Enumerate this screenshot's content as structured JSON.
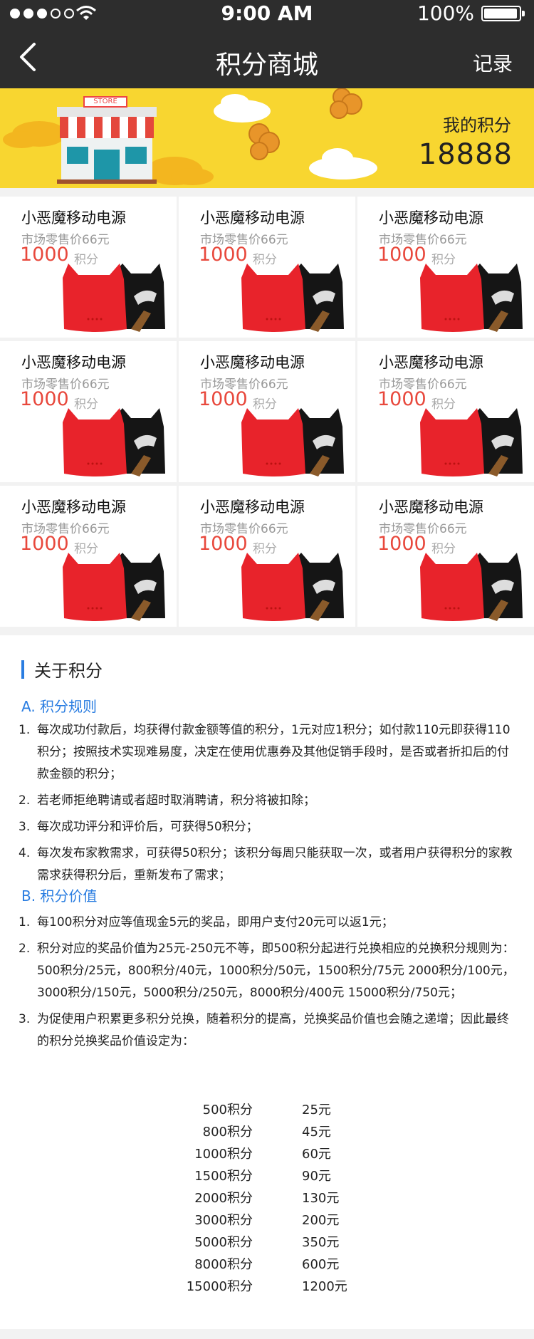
{
  "status_bar": {
    "time": "9:00 AM",
    "battery": "100%"
  },
  "nav": {
    "title": "积分商城",
    "right_action": "记录"
  },
  "banner": {
    "store_sign": "STORE",
    "points_label": "我的积分",
    "points_value": "18888"
  },
  "products": [
    {
      "title": "小恶魔移动电源",
      "market_price": "市场零售价66元",
      "points": "1000",
      "points_unit": "积分"
    },
    {
      "title": "小恶魔移动电源",
      "market_price": "市场零售价66元",
      "points": "1000",
      "points_unit": "积分"
    },
    {
      "title": "小恶魔移动电源",
      "market_price": "市场零售价66元",
      "points": "1000",
      "points_unit": "积分"
    },
    {
      "title": "小恶魔移动电源",
      "market_price": "市场零售价66元",
      "points": "1000",
      "points_unit": "积分"
    },
    {
      "title": "小恶魔移动电源",
      "market_price": "市场零售价66元",
      "points": "1000",
      "points_unit": "积分"
    },
    {
      "title": "小恶魔移动电源",
      "market_price": "市场零售价66元",
      "points": "1000",
      "points_unit": "积分"
    },
    {
      "title": "小恶魔移动电源",
      "market_price": "市场零售价66元",
      "points": "1000",
      "points_unit": "积分"
    },
    {
      "title": "小恶魔移动电源",
      "market_price": "市场零售价66元",
      "points": "1000",
      "points_unit": "积分"
    },
    {
      "title": "小恶魔移动电源",
      "market_price": "市场零售价66元",
      "points": "1000",
      "points_unit": "积分"
    }
  ],
  "about": {
    "title": "关于积分",
    "section_a": {
      "title": "A. 积分规则",
      "items": [
        {
          "num": "1.",
          "text": "每次成功付款后，均获得付款金额等值的积分，1元对应1积分；如付款110元即获得110积分；按照技术实现难易度，决定在使用优惠券及其他促销手段时，是否或者折扣后的付款金额的积分；"
        },
        {
          "num": "2.",
          "text": "若老师拒绝聘请或者超时取消聘请，积分将被扣除；"
        },
        {
          "num": "3.",
          "text": "每次成功评分和评价后，可获得50积分；"
        },
        {
          "num": "4.",
          "text": "每次发布家教需求，可获得50积分；该积分每周只能获取一次，或者用户获得积分的家教需求获得积分后，重新发布了需求；"
        }
      ]
    },
    "section_b": {
      "title": "B. 积分价值",
      "items": [
        {
          "num": "1.",
          "text": "每100积分对应等值现金5元的奖品，即用户支付20元可以返1元；"
        },
        {
          "num": "2.",
          "text": "积分对应的奖品价值为25元-250元不等，即500积分起进行兑换相应的兑换积分规则为：500积分/25元，800积分/40元，1000积分/50元，1500积分/75元 2000积分/100元，3000积分/150元，5000积分/250元，8000积分/400元 15000积分/750元；"
        },
        {
          "num": "3.",
          "text": "为促使用户积累更多积分兑换，随着积分的提高，兑换奖品价值也会随之递增；因此最终的积分兑换奖品价值设定为："
        }
      ]
    },
    "value_table": [
      {
        "points": "500积分",
        "value": "25元"
      },
      {
        "points": "800积分",
        "value": "45元"
      },
      {
        "points": "1000积分",
        "value": "60元"
      },
      {
        "points": "1500积分",
        "value": "90元"
      },
      {
        "points": "2000积分",
        "value": "130元"
      },
      {
        "points": "3000积分",
        "value": "200元"
      },
      {
        "points": "5000积分",
        "value": "350元"
      },
      {
        "points": "8000积分",
        "value": "600元"
      },
      {
        "points": "15000积分",
        "value": "1200元"
      }
    ]
  },
  "colors": {
    "bar": "#2d2d2d",
    "banner": "#f8d630",
    "price": "#e8483c",
    "accent": "#2a7de1"
  }
}
